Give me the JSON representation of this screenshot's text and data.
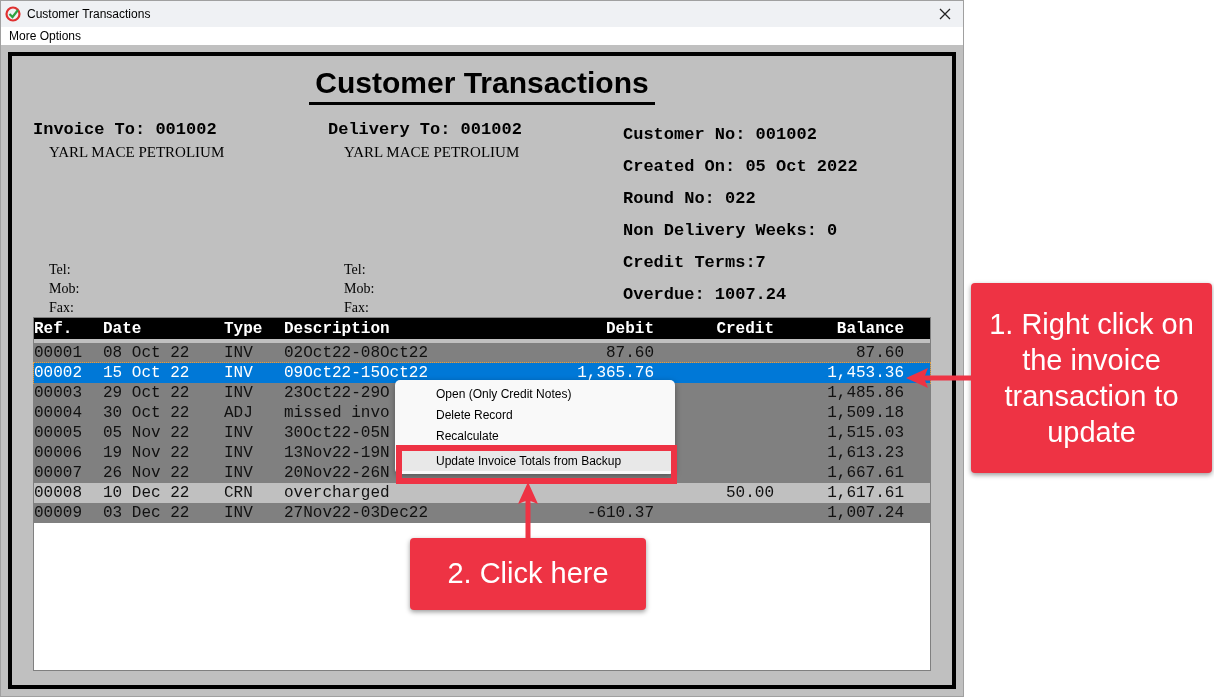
{
  "window": {
    "title": "Customer Transactions"
  },
  "menu_bar": [
    "More Options"
  ],
  "heading": "Customer Transactions",
  "invoice_to": {
    "label": "Invoice To: 001002",
    "name": "YARL MACE PETROLIUM",
    "contacts": [
      "Tel:",
      "Mob:",
      "Fax:"
    ]
  },
  "delivery_to": {
    "label": "Delivery To: 001002",
    "name": "YARL MACE PETROLIUM",
    "contacts": [
      "Tel:",
      "Mob:",
      "Fax:"
    ]
  },
  "customer_info": [
    "Customer No: 001002",
    "Created On: 05 Oct 2022",
    "Round No: 022",
    "Non Delivery Weeks: 0",
    "Credit Terms:7",
    "Overdue: 1007.24"
  ],
  "table": {
    "columns": [
      "Ref.",
      "Date",
      "Type",
      "Description",
      "Debit",
      "Credit",
      "Balance"
    ],
    "rows": [
      {
        "kind": "debit",
        "selected": false,
        "cells": [
          "00001",
          "08 Oct 22",
          "INV",
          "02Oct22-08Oct22",
          "87.60",
          "",
          "87.60"
        ]
      },
      {
        "kind": "debit",
        "selected": true,
        "cells": [
          "00002",
          "15 Oct 22",
          "INV",
          "09Oct22-15Oct22",
          "1,365.76",
          "",
          "1,453.36"
        ]
      },
      {
        "kind": "debit",
        "selected": false,
        "cells": [
          "00003",
          "29 Oct 22",
          "INV",
          "23Oct22-29O",
          "",
          "",
          "1,485.86"
        ]
      },
      {
        "kind": "debit",
        "selected": false,
        "cells": [
          "00004",
          "30 Oct 22",
          "ADJ",
          "missed invo",
          "",
          "",
          "1,509.18"
        ]
      },
      {
        "kind": "debit",
        "selected": false,
        "cells": [
          "00005",
          "05 Nov 22",
          "INV",
          "30Oct22-05N",
          "",
          "",
          "1,515.03"
        ]
      },
      {
        "kind": "debit",
        "selected": false,
        "cells": [
          "00006",
          "19 Nov 22",
          "INV",
          "13Nov22-19N",
          "",
          "",
          "1,613.23"
        ]
      },
      {
        "kind": "debit",
        "selected": false,
        "cells": [
          "00007",
          "26 Nov 22",
          "INV",
          "20Nov22-26N",
          "",
          "",
          "1,667.61"
        ]
      },
      {
        "kind": "credit",
        "selected": false,
        "cells": [
          "00008",
          "10 Dec 22",
          "CRN",
          "overcharged",
          "",
          "50.00",
          "1,617.61"
        ]
      },
      {
        "kind": "debit",
        "selected": false,
        "cells": [
          "00009",
          "03 Dec 22",
          "INV",
          "27Nov22-03Dec22",
          "-610.37",
          "",
          "1,007.24"
        ]
      }
    ]
  },
  "context_menu": [
    {
      "label": "Open (Only Credit Notes)",
      "selected": false
    },
    {
      "label": "Delete Record",
      "selected": false
    },
    {
      "label": "Recalculate",
      "selected": false
    },
    {
      "label": "Update Invoice Totals from Backup",
      "selected": true
    }
  ],
  "callouts": [
    "1. Right click on the invoice transaction to update",
    "2. Click here"
  ]
}
